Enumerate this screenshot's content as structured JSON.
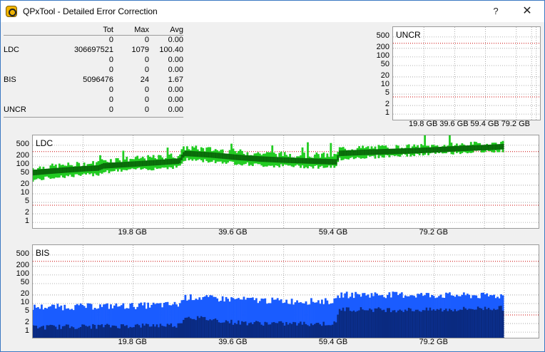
{
  "window": {
    "title": "QPxTool - Detailed Error Correction",
    "help_label": "?",
    "close_label": "✕",
    "icon": "qpxtool-app-icon"
  },
  "stats": {
    "headers": [
      "",
      "Tot",
      "Max",
      "Avg"
    ],
    "rows": [
      [
        "",
        "0",
        "0",
        "0.00"
      ],
      [
        "LDC",
        "306697521",
        "1079",
        "100.40"
      ],
      [
        "",
        "0",
        "0",
        "0.00"
      ],
      [
        "",
        "0",
        "0",
        "0.00"
      ],
      [
        "BIS",
        "5096476",
        "24",
        "1.67"
      ],
      [
        "",
        "0",
        "0",
        "0.00"
      ],
      [
        "",
        "0",
        "0",
        "0.00"
      ],
      [
        "UNCR",
        "0",
        "0",
        "0.00"
      ]
    ]
  },
  "colors": {
    "ldc_light": "#22cc22",
    "ldc_dark": "#0a6a0a",
    "bis_light": "#1a5cff",
    "bis_dark": "#0a2a80",
    "threshold_red": "#cc0000"
  },
  "chart_data": [
    {
      "type": "area",
      "title": "UNCR",
      "y_scale": "log",
      "y_ticks": [
        "500",
        "200",
        "100",
        "50",
        "20",
        "10",
        "5",
        "2",
        "1"
      ],
      "x_ticks": [
        "19.8 GB",
        "39.6 GB",
        "59.4 GB",
        "79.2 GB"
      ],
      "series": []
    },
    {
      "type": "area",
      "title": "LDC",
      "y_scale": "log",
      "y_ticks": [
        "500",
        "200",
        "100",
        "50",
        "20",
        "10",
        "5",
        "2",
        "1"
      ],
      "x_ticks": [
        "19.8 GB",
        "39.6 GB",
        "59.4 GB",
        "79.2 GB"
      ],
      "x_max_gb": 93,
      "series": [
        {
          "x": [
            0,
            5,
            10,
            13,
            14,
            20,
            25,
            29,
            30,
            35,
            40,
            45,
            50,
            55,
            60,
            60.5,
            65,
            70,
            75,
            80,
            85,
            90,
            93
          ],
          "max": [
            80,
            95,
            110,
            120,
            150,
            170,
            190,
            230,
            420,
            360,
            300,
            260,
            240,
            230,
            220,
            380,
            400,
            420,
            440,
            480,
            520,
            560,
            600
          ],
          "avg": [
            55,
            65,
            75,
            80,
            95,
            110,
            125,
            140,
            260,
            230,
            190,
            165,
            150,
            140,
            130,
            260,
            280,
            300,
            320,
            350,
            390,
            420,
            450
          ],
          "min": [
            30,
            40,
            45,
            50,
            60,
            70,
            80,
            90,
            160,
            140,
            120,
            100,
            95,
            90,
            85,
            170,
            190,
            210,
            230,
            260,
            290,
            310,
            330
          ]
        }
      ]
    },
    {
      "type": "area",
      "title": "BIS",
      "y_scale": "log",
      "y_ticks": [
        "500",
        "200",
        "100",
        "50",
        "20",
        "10",
        "5",
        "2",
        "1"
      ],
      "x_ticks": [
        "19.8 GB",
        "39.6 GB",
        "59.4 GB",
        "79.2 GB"
      ],
      "x_max_gb": 93,
      "series": [
        {
          "x": [
            0,
            10,
            20,
            29,
            30,
            40,
            50,
            60,
            60.5,
            70,
            80,
            90,
            93
          ],
          "max": [
            8,
            8.5,
            9,
            10,
            18,
            15,
            13,
            13,
            22,
            22,
            21,
            20,
            20
          ],
          "avg": [
            1.5,
            1.6,
            1.7,
            1.8,
            3.5,
            2.2,
            2.0,
            2.0,
            6.5,
            6.2,
            6.0,
            7.0,
            7.0
          ]
        }
      ]
    }
  ]
}
